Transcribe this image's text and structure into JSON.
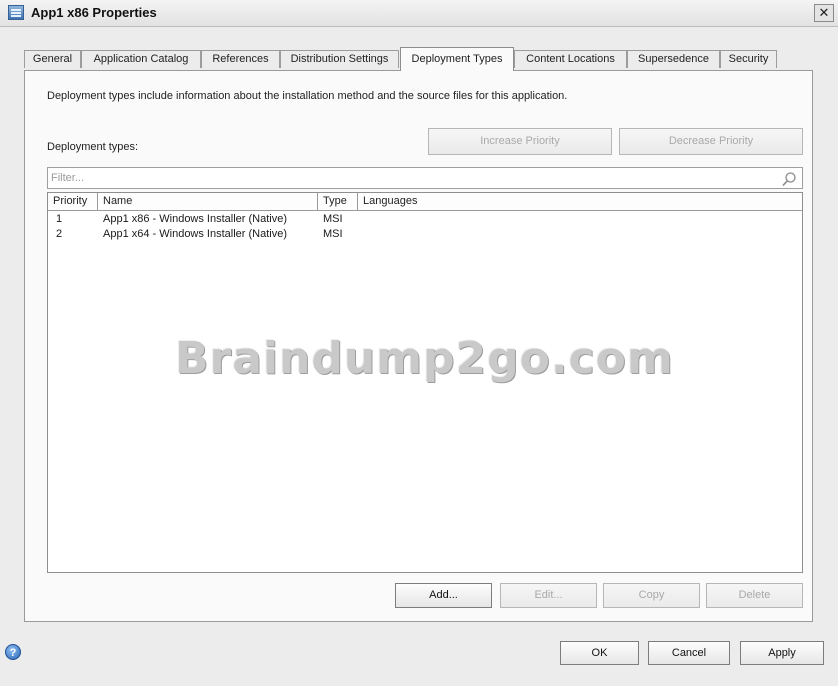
{
  "window": {
    "title": "App1 x86 Properties",
    "close_glyph": "✕"
  },
  "tabs": [
    {
      "label": "General"
    },
    {
      "label": "Application Catalog"
    },
    {
      "label": "References"
    },
    {
      "label": "Distribution Settings"
    },
    {
      "label": "Deployment Types",
      "active": true
    },
    {
      "label": "Content Locations"
    },
    {
      "label": "Supersedence"
    },
    {
      "label": "Security"
    }
  ],
  "panel": {
    "description": "Deployment types include information about the installation method and the source files for this application.",
    "deployment_types_label": "Deployment types:",
    "increase_priority": "Increase Priority",
    "decrease_priority": "Decrease Priority",
    "filter_placeholder": "Filter...",
    "columns": [
      "Priority",
      "Name",
      "Type",
      "Languages"
    ],
    "rows": [
      {
        "priority": "1",
        "name": "App1 x86 - Windows Installer (Native)",
        "type": "MSI",
        "languages": ""
      },
      {
        "priority": "2",
        "name": "App1 x64 - Windows Installer (Native)",
        "type": "MSI",
        "languages": ""
      }
    ],
    "add": "Add...",
    "edit": "Edit...",
    "copy": "Copy",
    "delete": "Delete"
  },
  "watermark": "Braindump2go.com",
  "footer": {
    "help_glyph": "?",
    "ok": "OK",
    "cancel": "Cancel",
    "apply": "Apply"
  },
  "icons": {
    "app": "properties-window-icon",
    "search": "search-icon",
    "help": "help-icon",
    "close": "close-icon"
  }
}
